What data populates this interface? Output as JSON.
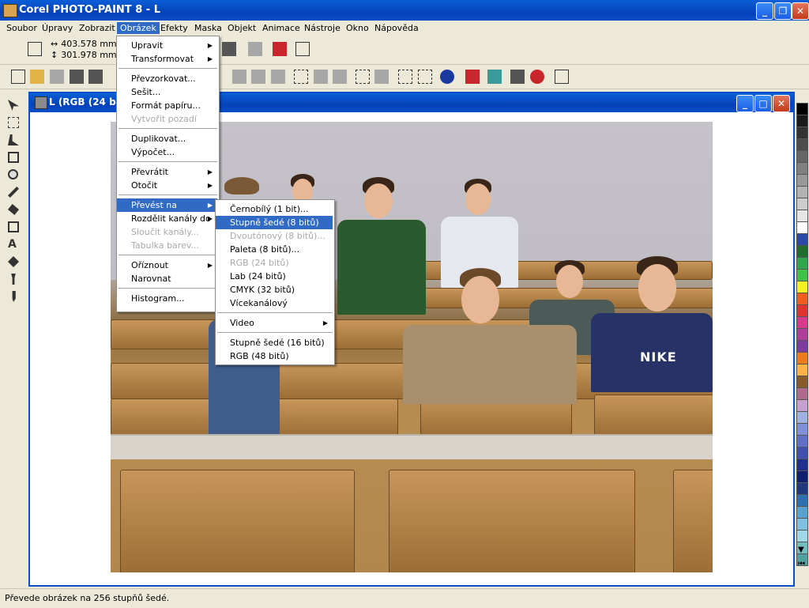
{
  "window": {
    "title": "Corel PHOTO-PAINT 8 - L"
  },
  "menubar": [
    "Soubor",
    "Úpravy",
    "Zobrazit",
    "Obrázek",
    "Efekty",
    "Maska",
    "Objekt",
    "Animace",
    "Nástroje",
    "Okno",
    "Nápověda"
  ],
  "toolbar": {
    "width_value": "403.578 mm",
    "height_value": "301.978 mm"
  },
  "document": {
    "title": "L  (RGB (24 bi"
  },
  "obrazek_menu": [
    {
      "label": "Upravit",
      "submenu": true
    },
    {
      "label": "Transformovat",
      "submenu": true
    },
    {
      "sep": true
    },
    {
      "label": "Převzorkovat..."
    },
    {
      "label": "Sešit..."
    },
    {
      "label": "Formát papíru..."
    },
    {
      "label": "Vytvořit pozadí",
      "disabled": true
    },
    {
      "sep": true
    },
    {
      "label": "Duplikovat..."
    },
    {
      "label": "Výpočet..."
    },
    {
      "sep": true
    },
    {
      "label": "Převrátit",
      "submenu": true
    },
    {
      "label": "Otočit",
      "submenu": true
    },
    {
      "sep": true
    },
    {
      "label": "Převést na",
      "submenu": true,
      "selected": true
    },
    {
      "label": "Rozdělit kanály do",
      "submenu": true
    },
    {
      "label": "Sloučit kanály...",
      "disabled": true
    },
    {
      "label": "Tabulka barev...",
      "disabled": true
    },
    {
      "sep": true
    },
    {
      "label": "Oříznout",
      "submenu": true
    },
    {
      "label": "Narovnat"
    },
    {
      "sep": true
    },
    {
      "label": "Histogram..."
    }
  ],
  "prevest_menu": [
    {
      "label": "Černobílý (1 bit)..."
    },
    {
      "label": "Stupně šedé (8 bitů)",
      "selected": true
    },
    {
      "label": "Dvoutónový (8 bitů)...",
      "disabled": true
    },
    {
      "label": "Paleta (8 bitů)..."
    },
    {
      "label": "RGB (24 bitů)",
      "disabled": true
    },
    {
      "label": "Lab (24 bitů)"
    },
    {
      "label": "CMYK (32 bitů)"
    },
    {
      "label": "Vícekanálový"
    },
    {
      "sep": true
    },
    {
      "label": "Video",
      "submenu": true
    },
    {
      "sep": true
    },
    {
      "label": "Stupně šedé (16 bitů)"
    },
    {
      "label": "RGB (48 bitů)"
    }
  ],
  "photo": {
    "shirt_text": "NIKE"
  },
  "palette_colors": [
    "#000000",
    "#1a1a1a",
    "#333333",
    "#4d4d4d",
    "#666666",
    "#808080",
    "#999999",
    "#b3b3b3",
    "#cccccc",
    "#e6e6e6",
    "#ffffff",
    "#2b4aa8",
    "#1f6e2e",
    "#2ea84a",
    "#3fc24a",
    "#f7f21f",
    "#f25c1f",
    "#e0332f",
    "#d63a8a",
    "#b03c9c",
    "#7d3aa0",
    "#ef7a1a",
    "#ffb347",
    "#8a5a2b",
    "#b06a8c",
    "#c8a0d0",
    "#a0b0e0",
    "#8090d8",
    "#6070c8",
    "#4050b0",
    "#203090",
    "#102070",
    "#203880",
    "#3070b0",
    "#5aa0d0",
    "#80c0e0",
    "#a0d8e8",
    "#70c0c0",
    "#50a0a0"
  ],
  "status": {
    "text": "Převede obrázek na 256 stupňů šedé."
  }
}
